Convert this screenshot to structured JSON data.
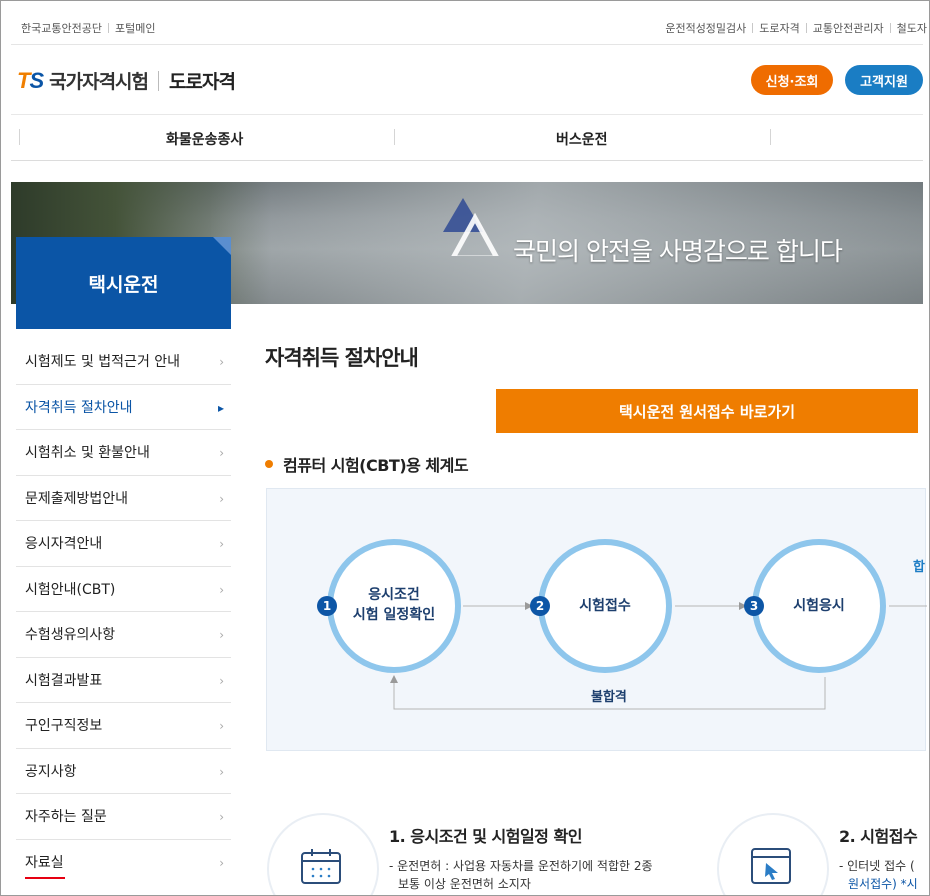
{
  "util": {
    "left": [
      "한국교통안전공단",
      "포털메인"
    ],
    "right": [
      "운전적성정밀검사",
      "도로자격",
      "교통안전관리자",
      "철도자"
    ]
  },
  "header": {
    "logo_t": "T",
    "logo_s": "S",
    "logo_name": "국가자격시험",
    "site_name": "도로자격",
    "apply_label": "신청·조회",
    "support_label": "고객지원"
  },
  "gnb": [
    "화물운송종사",
    "버스운전"
  ],
  "banner": {
    "text": "국민의 안전을 사명감으로 합니다"
  },
  "side": {
    "title": "택시운전",
    "items": [
      {
        "label": "시험제도 및 법적근거 안내",
        "active": false
      },
      {
        "label": "자격취득 절차안내",
        "active": true
      },
      {
        "label": "시험취소 및 환불안내",
        "active": false
      },
      {
        "label": "문제출제방법안내",
        "active": false
      },
      {
        "label": "응시자격안내",
        "active": false
      },
      {
        "label": "시험안내(CBT)",
        "active": false
      },
      {
        "label": "수험생유의사항",
        "active": false
      },
      {
        "label": "시험결과발표",
        "active": false
      },
      {
        "label": "구인구직정보",
        "active": false
      },
      {
        "label": "공지사항",
        "active": false
      },
      {
        "label": "자주하는 질문",
        "active": false
      },
      {
        "label": "자료실",
        "active": false
      }
    ]
  },
  "main": {
    "title": "자격취득 절차안내",
    "cta_label": "택시운전 원서접수 바로가기",
    "section_title": "컴퓨터 시험(CBT)용 체계도"
  },
  "flow": {
    "steps": [
      {
        "num": "1",
        "line1": "응시조건",
        "line2": "시험 일정확인"
      },
      {
        "num": "2",
        "line1": "시험접수",
        "line2": ""
      },
      {
        "num": "3",
        "line1": "시험응시",
        "line2": ""
      }
    ],
    "fail_label": "불합격",
    "next_hint": "합"
  },
  "steps": [
    {
      "title": "1. 응시조건 및 시험일정 확인",
      "desc1": "- 운전면허 : 사업용 자동차를 운전하기에 적합한 2종",
      "desc2": "보통 이상 운전면허 소지자"
    },
    {
      "title": "2. 시험접수",
      "desc1": "- 인터넷 접수 (",
      "desc2": "원서접수) *시"
    }
  ],
  "colors": {
    "brand_blue": "#0b55a6",
    "accent_orange": "#ef7d00",
    "flow_ring": "#8ec6ec",
    "alert_red": "#e60012"
  },
  "icons": [
    "triangle-logo-icon",
    "calendar-icon",
    "cursor-window-icon",
    "chevron-right-icon"
  ]
}
